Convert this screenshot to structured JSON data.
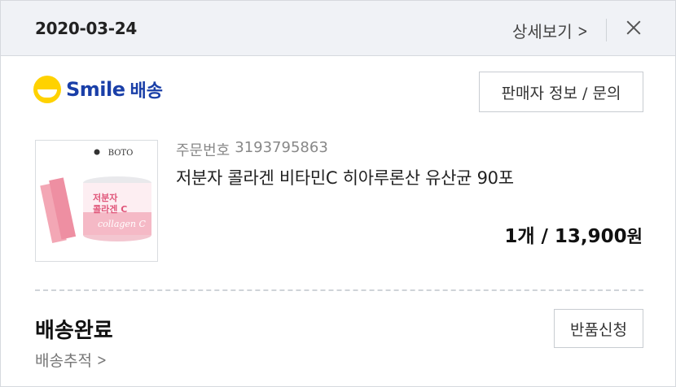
{
  "header": {
    "order_date": "2020-03-24",
    "detail_label": "상세보기",
    "detail_chevron": ">",
    "close_icon": "close-icon"
  },
  "delivery": {
    "brand": "Smile",
    "brand_suffix": "배송",
    "brand_color": "#1a3fa8",
    "logo_color": "#ffd200",
    "seller_button_label": "판매자 정보 / 문의"
  },
  "product": {
    "thumbnail_brand": "BOTO",
    "thumbnail_label_1": "저분자",
    "thumbnail_label_2": "콜라겐 C",
    "thumbnail_script": "collagen C",
    "order_number_label": "주문번호",
    "order_number": "3193795863",
    "name": "저분자 콜라겐 비타민C 히아루론산 유산균 90포",
    "quantity": "1개",
    "separator": " / ",
    "price": "13,900",
    "price_unit": "원"
  },
  "status": {
    "title": "배송완료",
    "track_label": "배송추적",
    "track_chevron": ">",
    "return_button_label": "반품신청"
  }
}
